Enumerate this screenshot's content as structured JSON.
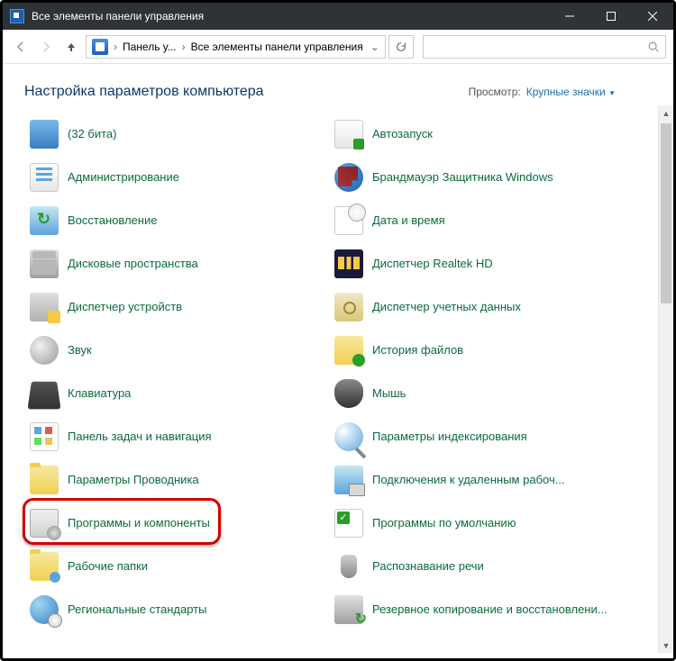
{
  "window": {
    "title": "Все элементы панели управления"
  },
  "breadcrumb": {
    "root": "Панель у...",
    "current": "Все элементы панели управления"
  },
  "header": {
    "heading": "Настройка параметров компьютера",
    "viewby_label": "Просмотр:",
    "viewby_value": "Крупные значки"
  },
  "items": {
    "a1": "(32 бита)",
    "a2": "Автозапуск",
    "b1": "Администрирование",
    "b2": "Брандмауэр Защитника Windows",
    "c1": "Восстановление",
    "c2": "Дата и время",
    "d1": "Дисковые пространства",
    "d2": "Диспетчер Realtek HD",
    "e1": "Диспетчер устройств",
    "e2": "Диспетчер учетных данных",
    "f1": "Звук",
    "f2": "История файлов",
    "g1": "Клавиатура",
    "g2": "Мышь",
    "h1": "Панель задач и навигация",
    "h2": "Параметры индексирования",
    "i1": "Параметры Проводника",
    "i2": "Подключения к удаленным рабоч...",
    "j1": "Программы и компоненты",
    "j2": "Программы по умолчанию",
    "k1": "Рабочие папки",
    "k2": "Распознавание речи",
    "l1": "Региональные стандарты",
    "l2": "Резервное копирование и восстановлени..."
  },
  "highlighted_item": "j1"
}
